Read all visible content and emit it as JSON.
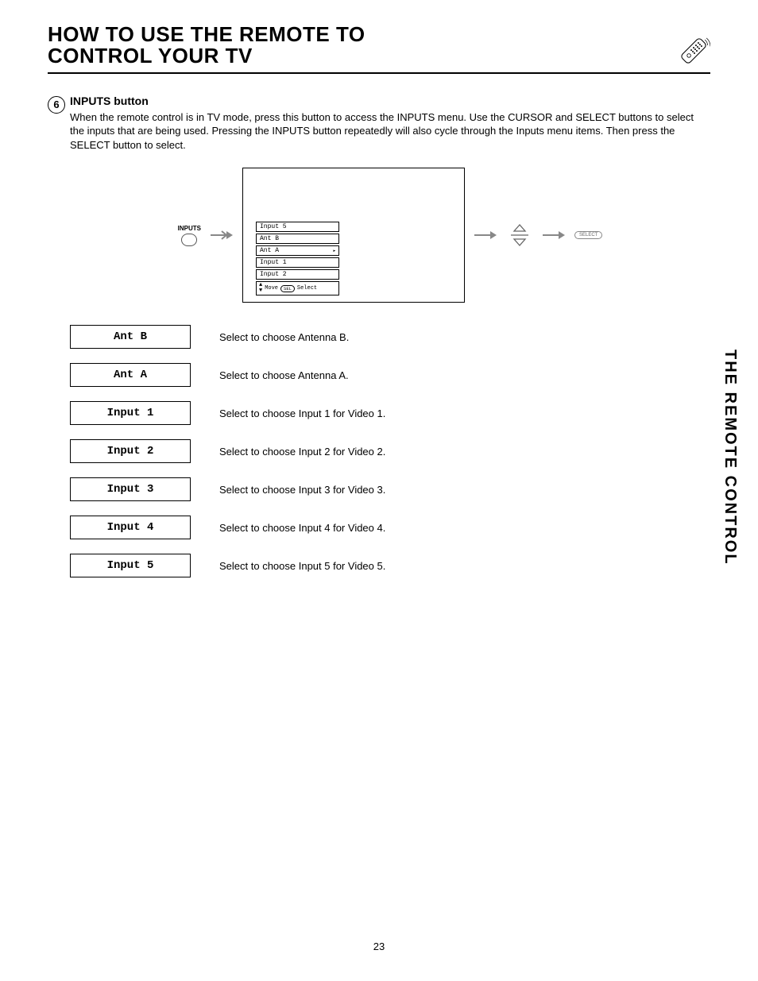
{
  "header": {
    "title_line1": "HOW TO USE THE REMOTE TO",
    "title_line2": "CONTROL YOUR TV"
  },
  "section": {
    "step_number": "6",
    "heading": "INPUTS button",
    "paragraph": "When the remote control is in TV mode, press this button to access the INPUTS menu.  Use the CURSOR and SELECT buttons to select the inputs that are being used.  Pressing the INPUTS button repeatedly will also cycle through the Inputs menu items.  Then press the SELECT button to select."
  },
  "diagram": {
    "inputs_label": "INPUTS",
    "menu_items": [
      "Input 5",
      "Ant B",
      "Ant A",
      "Input 1",
      "Input 2"
    ],
    "menu_selected_index": 2,
    "menu_footer_move": "Move",
    "menu_footer_sel_badge": "SEL",
    "menu_footer_select": "Select",
    "select_button_label": "SELECT"
  },
  "options": [
    {
      "label": "Ant B",
      "desc": "Select to choose Antenna B."
    },
    {
      "label": "Ant A",
      "desc": "Select to choose Antenna A."
    },
    {
      "label": "Input 1",
      "desc": "Select to choose Input 1 for Video 1."
    },
    {
      "label": "Input 2",
      "desc": "Select to choose Input 2 for Video 2."
    },
    {
      "label": "Input 3",
      "desc": "Select to choose Input 3 for Video 3."
    },
    {
      "label": "Input 4",
      "desc": "Select to choose Input 4 for Video 4."
    },
    {
      "label": "Input 5",
      "desc": "Select to choose Input 5 for Video 5."
    }
  ],
  "side_tab": "THE REMOTE CONTROL",
  "page_number": "23"
}
